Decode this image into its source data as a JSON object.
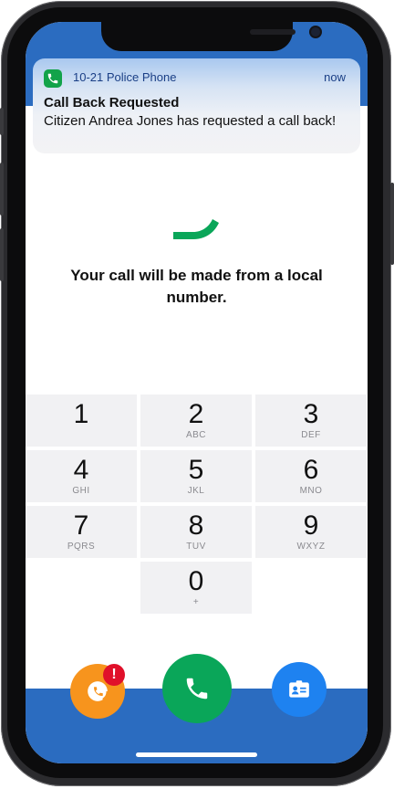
{
  "notification": {
    "app_name": "10-21 Police Phone",
    "time": "now",
    "title": "Call Back Requested",
    "body": "Citizen Andrea Jones has requested a call back!",
    "app_icon": "phone-icon"
  },
  "main": {
    "message": "Your call will be made from a local number."
  },
  "keypad": [
    {
      "digit": "1",
      "letters": ""
    },
    {
      "digit": "2",
      "letters": "ABC"
    },
    {
      "digit": "3",
      "letters": "DEF"
    },
    {
      "digit": "4",
      "letters": "GHI"
    },
    {
      "digit": "5",
      "letters": "JKL"
    },
    {
      "digit": "6",
      "letters": "MNO"
    },
    {
      "digit": "7",
      "letters": "PQRS"
    },
    {
      "digit": "8",
      "letters": "TUV"
    },
    {
      "digit": "9",
      "letters": "WXYZ"
    },
    {
      "digit": "0",
      "letters": "+"
    }
  ],
  "actions": {
    "left_icon": "call-history-icon",
    "badge": "!",
    "center_icon": "phone-icon",
    "right_icon": "contact-card-icon"
  },
  "colors": {
    "band": "#2b6cc0",
    "call_green": "#0aa659",
    "orange": "#f7941d",
    "blue": "#1e82f0",
    "badge_red": "#e0102a"
  }
}
